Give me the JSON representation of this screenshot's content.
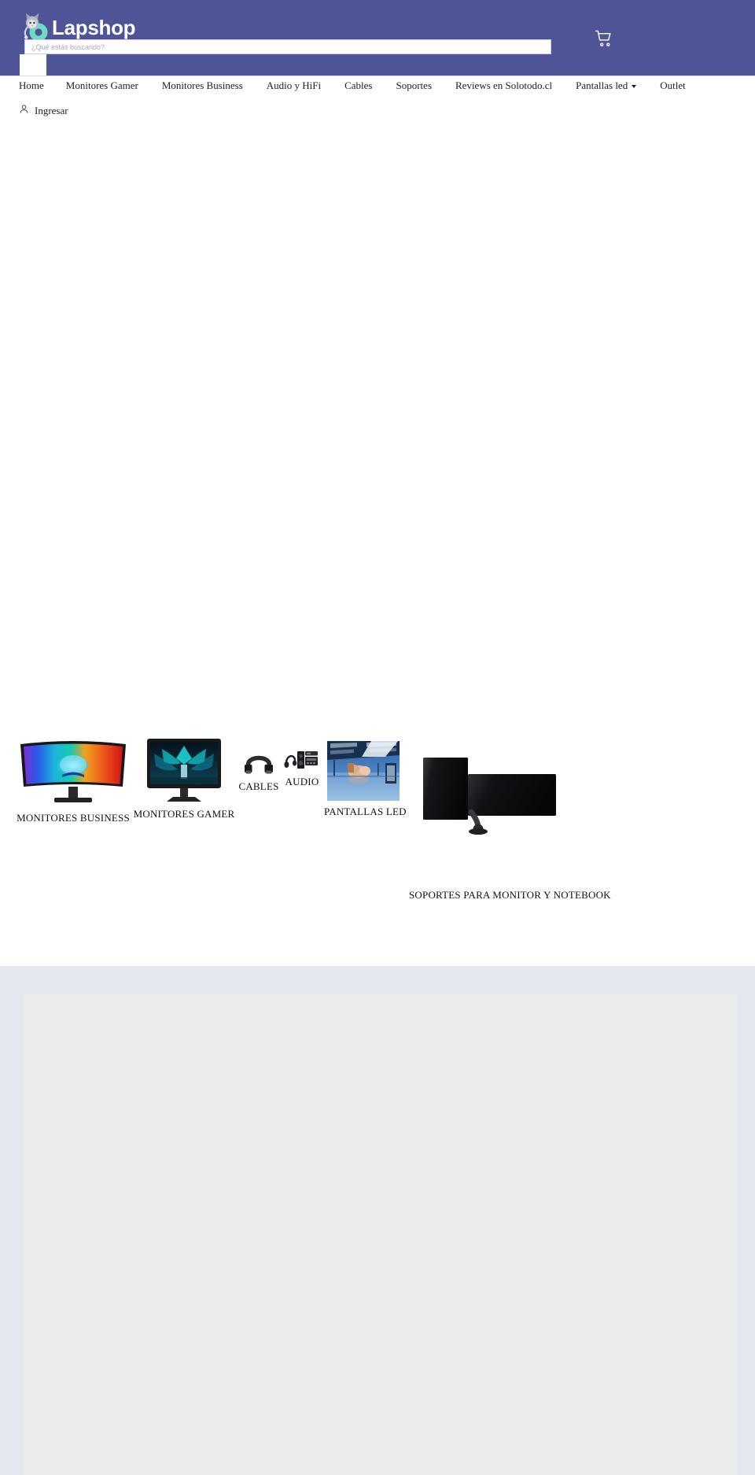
{
  "site": {
    "brand_name": "Lapshop",
    "brand_mark_icon": "cat-donut-logo-icon",
    "theme_color": "#4f5496",
    "accent_color": "#6ddcc0"
  },
  "header": {
    "search": {
      "placeholder": "¿Qué estás buscando?",
      "value": "",
      "button_icon": "search-icon",
      "button_label": ""
    },
    "cart": {
      "icon": "shopping-cart-icon",
      "label": ""
    }
  },
  "nav": {
    "items": [
      {
        "label": "Home",
        "has_dropdown": false
      },
      {
        "label": "Monitores Gamer",
        "has_dropdown": false
      },
      {
        "label": "Monitores Business",
        "has_dropdown": false
      },
      {
        "label": "Audio y HiFi",
        "has_dropdown": false
      },
      {
        "label": "Cables",
        "has_dropdown": false
      },
      {
        "label": "Soportes",
        "has_dropdown": false
      },
      {
        "label": "Reviews en Solotodo.cl",
        "has_dropdown": false
      },
      {
        "label": "Pantallas led",
        "has_dropdown": true
      },
      {
        "label": "Outlet",
        "has_dropdown": false
      }
    ]
  },
  "account": {
    "icon": "user-account-icon",
    "label": "Ingresar"
  },
  "categories": {
    "items": [
      {
        "label": "MONITORES BUSINESS",
        "icon": "curved-business-monitor-icon"
      },
      {
        "label": "MONITORES GAMER",
        "icon": "gaming-monitor-icon"
      },
      {
        "label": "CABLES",
        "icon": "hdmi-cable-icon"
      },
      {
        "label": "AUDIO",
        "icon": "speaker-system-icon"
      },
      {
        "label": "PANTALLAS LED",
        "icon": "led-wall-display-icon"
      },
      {
        "label": "SOPORTES PARA MONITOR Y NOTEBOOK",
        "icon": "dual-monitor-arm-icon"
      }
    ]
  },
  "lower_section": {
    "background_color": "#e3e9ee",
    "panel_color": "#ebebeb",
    "content": ""
  }
}
